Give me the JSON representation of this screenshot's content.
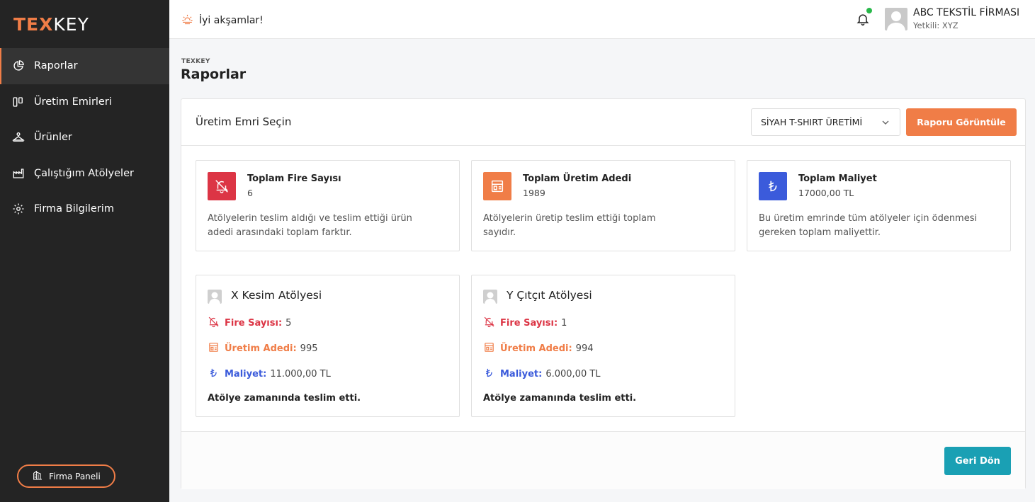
{
  "brand": {
    "part1": "TEX",
    "part2": "KEY"
  },
  "sidebar": {
    "items": [
      {
        "label": "Raporlar",
        "icon": "pie-chart-icon",
        "active": true
      },
      {
        "label": "Üretim Emirleri",
        "icon": "kanban-icon"
      },
      {
        "label": "Ürünler",
        "icon": "hanger-icon"
      },
      {
        "label": "Çalıştığım Atölyeler",
        "icon": "factory-icon"
      },
      {
        "label": "Firma Bilgilerim",
        "icon": "gear-icon"
      }
    ],
    "panel_button": "Firma Paneli"
  },
  "topbar": {
    "greeting": "İyi akşamlar!",
    "company": "ABC TEKSTİL FİRMASI",
    "company_sub": "Yetkili: XYZ"
  },
  "page": {
    "breadcrumb": "TEXKEY",
    "title": "Raporlar"
  },
  "report": {
    "select_label": "Üretim Emri Seçin",
    "selected_order": "SİYAH T-SHIRT ÜRETİMİ",
    "view_button": "Raporu Görüntüle",
    "back_button": "Geri Dön"
  },
  "stats": [
    {
      "title": "Toplam Fire Sayısı",
      "value": "6",
      "desc": "Atölyelerin teslim aldığı ve teslim ettiği ürün adedi arasındaki toplam farktır.",
      "color": "#dc3545"
    },
    {
      "title": "Toplam Üretim Adedi",
      "value": "1989",
      "desc": "Atölyelerin üretip teslim ettiği toplam sayıdır.",
      "color": "#f07d47"
    },
    {
      "title": "Toplam Maliyet",
      "value": "17000,00 TL",
      "desc": "Bu üretim emrinde tüm atölyeler için ödenmesi gereken toplam maliyettir.",
      "color": "#3b5bdb"
    }
  ],
  "workshops": [
    {
      "name": "X Kesim Atölyesi",
      "fire_label": "Fire Sayısı:",
      "fire": "5",
      "prod_label": "Üretim Adedi:",
      "prod": "995",
      "cost_label": "Maliyet:",
      "cost": "11.000,00 TL",
      "note": "Atölye zamanında teslim etti."
    },
    {
      "name": "Y Çıtçıt Atölyesi",
      "fire_label": "Fire Sayısı:",
      "fire": "1",
      "prod_label": "Üretim Adedi:",
      "prod": "994",
      "cost_label": "Maliyet:",
      "cost": "6.000,00 TL",
      "note": "Atölye zamanında teslim etti."
    }
  ],
  "colors": {
    "accent": "#f07d47",
    "danger": "#dc3545",
    "primary": "#3b5bdb",
    "teal": "#1aa0b4",
    "sidebar": "#242424"
  }
}
